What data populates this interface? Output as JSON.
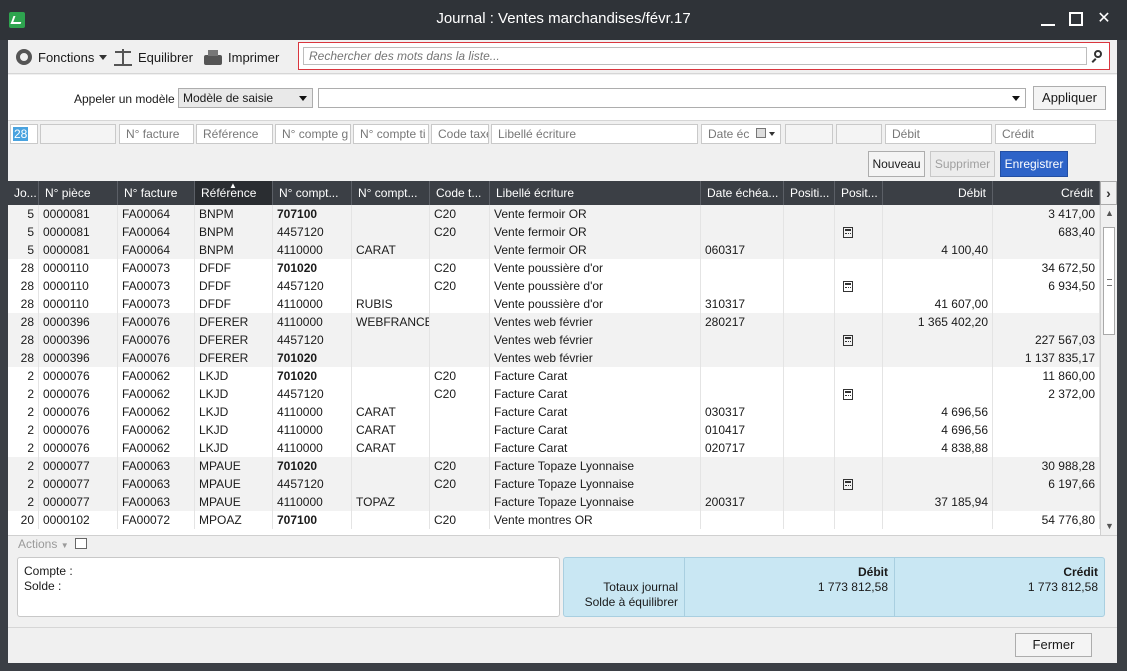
{
  "window": {
    "title": "Journal : Ventes marchandises/févr.17"
  },
  "toolbar": {
    "functions_label": "Fonctions",
    "balance_label": "Equilibrer",
    "print_label": "Imprimer",
    "search_placeholder": "Rechercher des mots dans la liste..."
  },
  "model": {
    "label": "Appeler un modèle",
    "selected": "Modèle de saisie",
    "combo_value": "",
    "apply_label": "Appliquer"
  },
  "entry": {
    "day": "28",
    "piece": "",
    "facture": "N° facture",
    "reference": "Référence",
    "compte_g": "N° compte g",
    "compte_t": "N° compte ti",
    "code_taxe": "Code taxe",
    "libelle": "Libellé écriture",
    "date_ech": "Date éc",
    "pos1": "",
    "pos2": "",
    "debit": "Débit",
    "credit": "Crédit"
  },
  "buttons": {
    "new": "Nouveau",
    "delete": "Supprimer",
    "save": "Enregistrer",
    "close": "Fermer"
  },
  "grid": {
    "columns": [
      "Jo...",
      "N° pièce",
      "N° facture",
      "Référence",
      "N° compt...",
      "N° compt...",
      "Code t...",
      "Libellé écriture",
      "Date échéa...",
      "Positi...",
      "Posit...",
      "Débit",
      "Crédit"
    ],
    "rows": [
      {
        "jour": "5",
        "piece": "0000081",
        "facture": "FA00064",
        "ref": "BNPM",
        "cg": "707100",
        "cg_bold": true,
        "ct": "",
        "code": "C20",
        "lib": "Vente fermoir OR",
        "date": "",
        "calc": false,
        "debit": "",
        "credit": "3 417,00",
        "g": 0
      },
      {
        "jour": "5",
        "piece": "0000081",
        "facture": "FA00064",
        "ref": "BNPM",
        "cg": "4457120",
        "cg_bold": false,
        "ct": "",
        "code": "C20",
        "lib": "Vente fermoir OR",
        "date": "",
        "calc": true,
        "debit": "",
        "credit": "683,40",
        "g": 0
      },
      {
        "jour": "5",
        "piece": "0000081",
        "facture": "FA00064",
        "ref": "BNPM",
        "cg": "4110000",
        "cg_bold": false,
        "ct": "CARAT",
        "code": "",
        "lib": "Vente fermoir OR",
        "date": "060317",
        "calc": false,
        "debit": "4 100,40",
        "credit": "",
        "g": 0
      },
      {
        "jour": "28",
        "piece": "0000110",
        "facture": "FA00073",
        "ref": "DFDF",
        "cg": "701020",
        "cg_bold": true,
        "ct": "",
        "code": "C20",
        "lib": "Vente poussière d'or",
        "date": "",
        "calc": false,
        "debit": "",
        "credit": "34 672,50",
        "g": 1
      },
      {
        "jour": "28",
        "piece": "0000110",
        "facture": "FA00073",
        "ref": "DFDF",
        "cg": "4457120",
        "cg_bold": false,
        "ct": "",
        "code": "C20",
        "lib": "Vente poussière d'or",
        "date": "",
        "calc": true,
        "debit": "",
        "credit": "6 934,50",
        "g": 1
      },
      {
        "jour": "28",
        "piece": "0000110",
        "facture": "FA00073",
        "ref": "DFDF",
        "cg": "4110000",
        "cg_bold": false,
        "ct": "RUBIS",
        "code": "",
        "lib": "Vente poussière d'or",
        "date": "310317",
        "calc": false,
        "debit": "41 607,00",
        "credit": "",
        "g": 1
      },
      {
        "jour": "28",
        "piece": "0000396",
        "facture": "FA00076",
        "ref": "DFERER",
        "cg": "4110000",
        "cg_bold": false,
        "ct": "WEBFRANCE",
        "code": "",
        "lib": "Ventes web février",
        "date": "280217",
        "calc": false,
        "debit": "1 365 402,20",
        "credit": "",
        "g": 0
      },
      {
        "jour": "28",
        "piece": "0000396",
        "facture": "FA00076",
        "ref": "DFERER",
        "cg": "4457120",
        "cg_bold": false,
        "ct": "",
        "code": "",
        "lib": "Ventes web février",
        "date": "",
        "calc": true,
        "debit": "",
        "credit": "227 567,03",
        "g": 0
      },
      {
        "jour": "28",
        "piece": "0000396",
        "facture": "FA00076",
        "ref": "DFERER",
        "cg": "701020",
        "cg_bold": true,
        "ct": "",
        "code": "",
        "lib": "Ventes web février",
        "date": "",
        "calc": false,
        "debit": "",
        "credit": "1 137 835,17",
        "g": 0
      },
      {
        "jour": "2",
        "piece": "0000076",
        "facture": "FA00062",
        "ref": "LKJD",
        "cg": "701020",
        "cg_bold": true,
        "ct": "",
        "code": "C20",
        "lib": "Facture Carat",
        "date": "",
        "calc": false,
        "debit": "",
        "credit": "11 860,00",
        "g": 1
      },
      {
        "jour": "2",
        "piece": "0000076",
        "facture": "FA00062",
        "ref": "LKJD",
        "cg": "4457120",
        "cg_bold": false,
        "ct": "",
        "code": "C20",
        "lib": "Facture Carat",
        "date": "",
        "calc": true,
        "debit": "",
        "credit": "2 372,00",
        "g": 1
      },
      {
        "jour": "2",
        "piece": "0000076",
        "facture": "FA00062",
        "ref": "LKJD",
        "cg": "4110000",
        "cg_bold": false,
        "ct": "CARAT",
        "code": "",
        "lib": "Facture Carat",
        "date": "030317",
        "calc": false,
        "debit": "4 696,56",
        "credit": "",
        "g": 1
      },
      {
        "jour": "2",
        "piece": "0000076",
        "facture": "FA00062",
        "ref": "LKJD",
        "cg": "4110000",
        "cg_bold": false,
        "ct": "CARAT",
        "code": "",
        "lib": "Facture Carat",
        "date": "010417",
        "calc": false,
        "debit": "4 696,56",
        "credit": "",
        "g": 1
      },
      {
        "jour": "2",
        "piece": "0000076",
        "facture": "FA00062",
        "ref": "LKJD",
        "cg": "4110000",
        "cg_bold": false,
        "ct": "CARAT",
        "code": "",
        "lib": "Facture Carat",
        "date": "020717",
        "calc": false,
        "debit": "4 838,88",
        "credit": "",
        "g": 1
      },
      {
        "jour": "2",
        "piece": "0000077",
        "facture": "FA00063",
        "ref": "MPAUE",
        "cg": "701020",
        "cg_bold": true,
        "ct": "",
        "code": "C20",
        "lib": "Facture Topaze Lyonnaise",
        "date": "",
        "calc": false,
        "debit": "",
        "credit": "30 988,28",
        "g": 0
      },
      {
        "jour": "2",
        "piece": "0000077",
        "facture": "FA00063",
        "ref": "MPAUE",
        "cg": "4457120",
        "cg_bold": false,
        "ct": "",
        "code": "C20",
        "lib": "Facture Topaze Lyonnaise",
        "date": "",
        "calc": true,
        "debit": "",
        "credit": "6 197,66",
        "g": 0
      },
      {
        "jour": "2",
        "piece": "0000077",
        "facture": "FA00063",
        "ref": "MPAUE",
        "cg": "4110000",
        "cg_bold": false,
        "ct": "TOPAZ",
        "code": "",
        "lib": "Facture Topaze Lyonnaise",
        "date": "200317",
        "calc": false,
        "debit": "37 185,94",
        "credit": "",
        "g": 0
      },
      {
        "jour": "20",
        "piece": "0000102",
        "facture": "FA00072",
        "ref": "MPOAZ",
        "cg": "707100",
        "cg_bold": true,
        "ct": "",
        "code": "C20",
        "lib": "Vente montres OR",
        "date": "",
        "calc": false,
        "debit": "",
        "credit": "54 776,80",
        "g": 1
      }
    ]
  },
  "footer": {
    "actions_label": "Actions"
  },
  "summary": {
    "account_label": "Compte :",
    "balance_label": "Solde :",
    "totals_label": "Totaux journal",
    "to_balance_label": "Solde à équilibrer",
    "debit_header": "Débit",
    "credit_header": "Crédit",
    "total_debit": "1 773 812,58",
    "total_credit": "1 773 812,58",
    "balance_debit": "",
    "balance_credit": ""
  }
}
